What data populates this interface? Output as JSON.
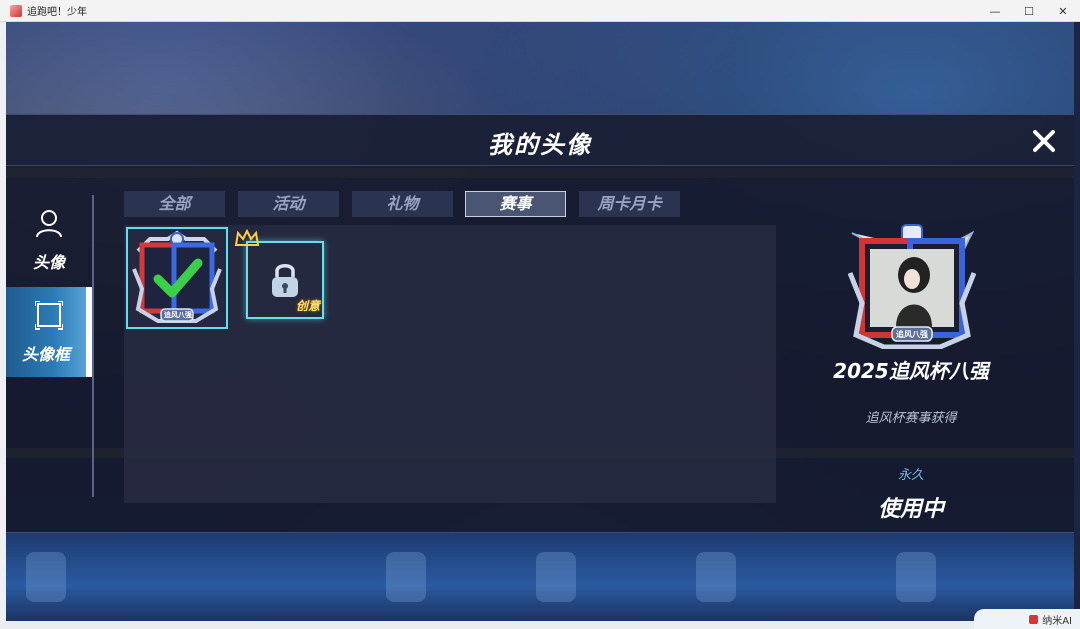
{
  "window": {
    "title": "追跑吧！少年",
    "minimize": "—",
    "maximize": "☐",
    "close": "✕"
  },
  "modal": {
    "title": "我的头像",
    "close_icon": "close-icon"
  },
  "side_tabs": [
    {
      "label": "头像",
      "icon": "user-icon",
      "active": false
    },
    {
      "label": "头像框",
      "icon": "frame-icon",
      "active": true
    }
  ],
  "filter_tabs": [
    {
      "label": "全部",
      "active": false
    },
    {
      "label": "活动",
      "active": false
    },
    {
      "label": "礼物",
      "active": false
    },
    {
      "label": "赛事",
      "active": true
    },
    {
      "label": "周卡月卡",
      "active": false
    }
  ],
  "frames": [
    {
      "state": "selected",
      "badge": "追风八强",
      "icon": "checkmark-icon"
    },
    {
      "state": "locked",
      "badge": "创意",
      "icon": "lock-icon"
    }
  ],
  "detail": {
    "frame_badge": "追风八强",
    "name": "2025追风杯八强",
    "source": "追风杯赛事获得",
    "duration": "永久",
    "status": "使用中"
  },
  "overlay": {
    "ai_label": "纳米AI"
  }
}
